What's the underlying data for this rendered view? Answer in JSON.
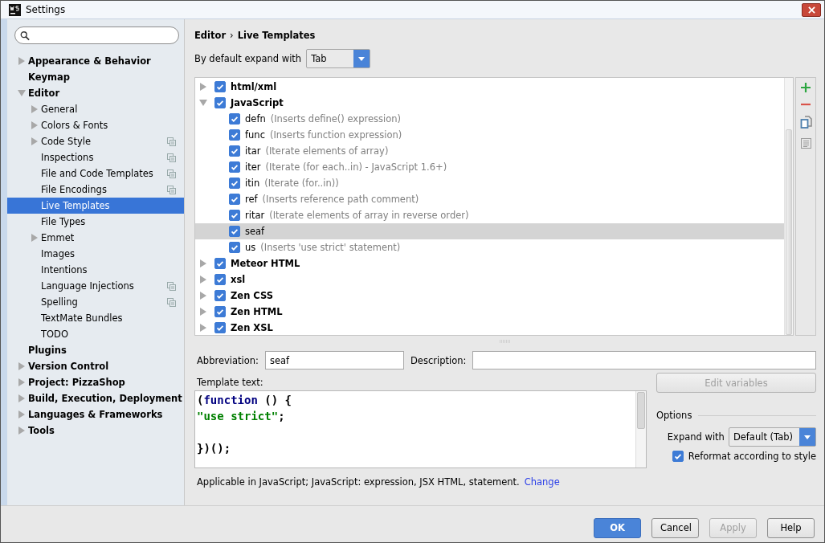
{
  "window": {
    "title": "Settings"
  },
  "sidebar": {
    "items": [
      {
        "label": "Appearance & Behavior",
        "expanded": false,
        "project_level": false,
        "selected": false
      },
      {
        "label": "Keymap",
        "project_level": false,
        "selected": false
      },
      {
        "label": "Editor",
        "expanded": true,
        "project_level": false,
        "selected": false,
        "children": [
          {
            "label": "General",
            "expanded": false,
            "project_level": false,
            "selected": false
          },
          {
            "label": "Colors & Fonts",
            "expanded": false,
            "project_level": false,
            "selected": false
          },
          {
            "label": "Code Style",
            "expanded": false,
            "project_level": true,
            "selected": false
          },
          {
            "label": "Inspections",
            "project_level": true,
            "selected": false
          },
          {
            "label": "File and Code Templates",
            "project_level": true,
            "selected": false
          },
          {
            "label": "File Encodings",
            "project_level": true,
            "selected": false
          },
          {
            "label": "Live Templates",
            "project_level": false,
            "selected": true
          },
          {
            "label": "File Types",
            "project_level": false,
            "selected": false
          },
          {
            "label": "Emmet",
            "expanded": false,
            "project_level": false,
            "selected": false
          },
          {
            "label": "Images",
            "project_level": false,
            "selected": false
          },
          {
            "label": "Intentions",
            "project_level": false,
            "selected": false
          },
          {
            "label": "Language Injections",
            "project_level": true,
            "selected": false
          },
          {
            "label": "Spelling",
            "project_level": true,
            "selected": false
          },
          {
            "label": "TextMate Bundles",
            "project_level": false,
            "selected": false
          },
          {
            "label": "TODO",
            "project_level": false,
            "selected": false
          }
        ]
      },
      {
        "label": "Plugins",
        "project_level": false,
        "selected": false
      },
      {
        "label": "Version Control",
        "expanded": false,
        "project_level": false,
        "selected": false
      },
      {
        "label": "Project: PizzaShop",
        "expanded": false,
        "project_level": false,
        "selected": false
      },
      {
        "label": "Build, Execution, Deployment",
        "expanded": false,
        "project_level": false,
        "selected": false
      },
      {
        "label": "Languages & Frameworks",
        "expanded": false,
        "project_level": false,
        "selected": false
      },
      {
        "label": "Tools",
        "expanded": false,
        "project_level": false,
        "selected": false
      }
    ]
  },
  "breadcrumb": {
    "items": [
      "Editor",
      "Live Templates"
    ],
    "separator": "›"
  },
  "expand_default": {
    "label": "By default expand with",
    "value": "Tab"
  },
  "templates": [
    {
      "name": "html/xml",
      "checked": true,
      "expanded": false
    },
    {
      "name": "JavaScript",
      "checked": true,
      "expanded": true,
      "children": [
        {
          "abbreviation": "defn",
          "description": "(Inserts define() expression)",
          "checked": true,
          "selected": false
        },
        {
          "abbreviation": "func",
          "description": "(Inserts function expression)",
          "checked": true,
          "selected": false
        },
        {
          "abbreviation": "itar",
          "description": "(Iterate elements of array)",
          "checked": true,
          "selected": false
        },
        {
          "abbreviation": "iter",
          "description": "(Iterate (for each..in) - JavaScript 1.6+)",
          "checked": true,
          "selected": false
        },
        {
          "abbreviation": "itin",
          "description": "(Iterate (for..in))",
          "checked": true,
          "selected": false
        },
        {
          "abbreviation": "ref",
          "description": "(Inserts reference path comment)",
          "checked": true,
          "selected": false
        },
        {
          "abbreviation": "ritar",
          "description": "(Iterate elements of array in reverse order)",
          "checked": true,
          "selected": false
        },
        {
          "abbreviation": "seaf",
          "checked": true,
          "selected": true
        },
        {
          "abbreviation": "us",
          "description": "(Inserts 'use strict' statement)",
          "checked": true,
          "selected": false
        }
      ]
    },
    {
      "name": "Meteor HTML",
      "checked": true,
      "expanded": false
    },
    {
      "name": "xsl",
      "checked": true,
      "expanded": false
    },
    {
      "name": "Zen CSS",
      "checked": true,
      "expanded": false
    },
    {
      "name": "Zen HTML",
      "checked": true,
      "expanded": false
    },
    {
      "name": "Zen XSL",
      "checked": true,
      "expanded": false
    }
  ],
  "editor": {
    "abbreviation": {
      "label": "Abbreviation:",
      "value": "seaf"
    },
    "description": {
      "label": "Description:"
    },
    "template_text": {
      "label": "Template text:",
      "lines": [
        {
          "tokens": [
            {
              "text": "(",
              "kind": "plain"
            },
            {
              "text": "function",
              "kind": "keyword"
            },
            {
              "text": " () {",
              "kind": "plain"
            }
          ]
        },
        {
          "tokens": [
            {
              "text": "\"use strict\"",
              "kind": "string"
            },
            {
              "text": ";",
              "kind": "plain"
            }
          ]
        },
        {
          "tokens": [
            {
              "text": "})();",
              "kind": "plain"
            }
          ],
          "blank_before": true
        }
      ]
    },
    "edit_variables": {
      "label": "Edit variables",
      "disabled": true
    },
    "options": {
      "title": "Options",
      "expand_with": {
        "label": "Expand with",
        "value": "Default (Tab)"
      },
      "reformat": {
        "label": "Reformat according to style",
        "checked": true
      }
    },
    "applicable": {
      "text": "Applicable in JavaScript; JavaScript: expression, JSX HTML, statement.",
      "link": "Change"
    }
  },
  "buttons": [
    {
      "label": "OK",
      "kind": "primary",
      "disabled": false
    },
    {
      "label": "Cancel",
      "kind": "normal",
      "disabled": false
    },
    {
      "label": "Apply",
      "kind": "normal",
      "disabled": true
    },
    {
      "label": "Help",
      "kind": "normal",
      "disabled": false
    }
  ]
}
